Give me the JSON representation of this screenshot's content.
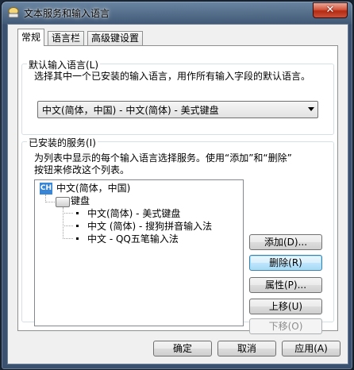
{
  "window": {
    "title": "文本服务和输入语言",
    "close_label": "✕"
  },
  "tabs": [
    {
      "label": "常规",
      "active": true
    },
    {
      "label": "语言栏",
      "active": false
    },
    {
      "label": "高级键设置",
      "active": false
    }
  ],
  "default_language": {
    "group_label": "默认输入语言(L)",
    "description": "选择其中一个已安装的输入语言，用作所有输入字段的默认语言。",
    "selected": "中文(简体，中国) - 中文(简体) - 美式键盘"
  },
  "installed_services": {
    "group_label": "已安装的服务(I)",
    "description_line1": "为列表中显示的每个输入语言选择服务。使用“添加”和“删除”",
    "description_line2": "按钮来修改这个列表。",
    "tree": {
      "language_badge": "CH",
      "language": "中文(简体，中国)",
      "category": "键盘",
      "items": [
        "中文(简体) - 美式键盘",
        "中文 (简体) - 搜狗拼音输入法",
        "中文 - QQ五笔输入法"
      ]
    },
    "buttons": {
      "add": "添加(D)...",
      "remove": "删除(R)",
      "properties": "属性(P)...",
      "move_up": "上移(U)",
      "move_down": "下移(O)"
    }
  },
  "footer": {
    "ok": "确定",
    "cancel": "取消",
    "apply": "应用(A)"
  },
  "colors": {
    "accent": "#3a86d6",
    "close": "#c9503a"
  }
}
